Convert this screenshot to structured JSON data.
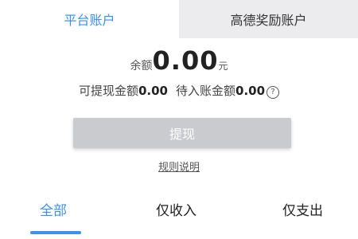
{
  "account_tabs": {
    "platform": "平台账户",
    "amap_reward": "高德奖励账户"
  },
  "balance": {
    "label": "余额",
    "amount": "0.00",
    "unit": "元"
  },
  "sub_balance": {
    "withdrawable_label": "可提现金额",
    "withdrawable_value": "0.00",
    "pending_label": "待入账金额",
    "pending_value": "0.00",
    "help_glyph": "?"
  },
  "withdraw_button": "提现",
  "rules_link": "规则说明",
  "filter_tabs": {
    "all": "全部",
    "income": "仅收入",
    "expense": "仅支出"
  },
  "colors": {
    "accent": "#3d8ff0",
    "disabled_button": "#c9cbcf",
    "inactive_tab_bg": "#ececef"
  },
  "icons": {
    "help": "question-circle-icon"
  }
}
